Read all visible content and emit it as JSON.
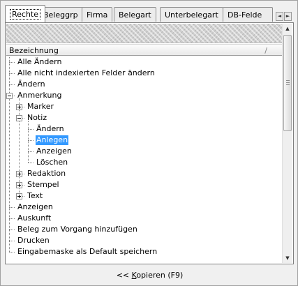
{
  "tabs": [
    "Rechte",
    "Beleggrp",
    "Firma",
    "Belegart",
    "Unterbelegart",
    "DB-Felde"
  ],
  "active_tab": "Rechte",
  "column_header": "Bezeichnung",
  "tree_items": [
    {
      "label": "Alle Ändern",
      "level": 0,
      "toggle": null,
      "selected": false
    },
    {
      "label": "Alle nicht indexierten Felder ändern",
      "level": 0,
      "toggle": null,
      "selected": false
    },
    {
      "label": "Ändern",
      "level": 0,
      "toggle": null,
      "selected": false
    },
    {
      "label": "Anmerkung",
      "level": 0,
      "toggle": "minus",
      "selected": false
    },
    {
      "label": "Marker",
      "level": 1,
      "toggle": "plus",
      "selected": false
    },
    {
      "label": "Notiz",
      "level": 1,
      "toggle": "minus",
      "selected": false
    },
    {
      "label": "Ändern",
      "level": 2,
      "toggle": null,
      "selected": false
    },
    {
      "label": "Anlegen",
      "level": 2,
      "toggle": null,
      "selected": true
    },
    {
      "label": "Anzeigen",
      "level": 2,
      "toggle": null,
      "selected": false
    },
    {
      "label": "Löschen",
      "level": 2,
      "toggle": null,
      "selected": false
    },
    {
      "label": "Redaktion",
      "level": 1,
      "toggle": "plus",
      "selected": false
    },
    {
      "label": "Stempel",
      "level": 1,
      "toggle": "plus",
      "selected": false
    },
    {
      "label": "Text",
      "level": 1,
      "toggle": "plus",
      "selected": false
    },
    {
      "label": "Anzeigen",
      "level": 0,
      "toggle": null,
      "selected": false
    },
    {
      "label": "Auskunft",
      "level": 0,
      "toggle": null,
      "selected": false
    },
    {
      "label": "Beleg zum Vorgang hinzufügen",
      "level": 0,
      "toggle": null,
      "selected": false
    },
    {
      "label": "Drucken",
      "level": 0,
      "toggle": null,
      "selected": false
    },
    {
      "label": "Eingabemaske als Default speichern",
      "level": 0,
      "toggle": null,
      "selected": false
    }
  ],
  "copy_button": {
    "prefix": "<< ",
    "accel": "K",
    "rest": "opieren (F9)"
  },
  "colors": {
    "selection": "#3399ff",
    "panel_bg": "#ffffff",
    "window_bg": "#f0f0f0"
  },
  "icons": {
    "tab_scroll_left": "◄",
    "tab_scroll_right": "►",
    "scroll_up": "▲",
    "scroll_down": "▼",
    "sort": "/",
    "grip": "≡"
  }
}
